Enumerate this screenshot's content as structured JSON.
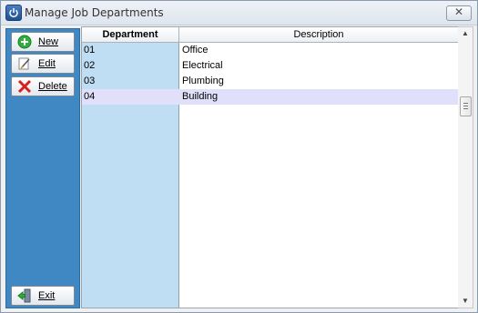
{
  "window": {
    "title": "Manage Job Departments",
    "close_glyph": "✕"
  },
  "sidebar": {
    "new_label": "New",
    "edit_label": "Edit",
    "delete_label": "Delete",
    "exit_label": "Exit"
  },
  "grid": {
    "columns": {
      "department": "Department",
      "description": "Description"
    },
    "rows": [
      {
        "department": "01",
        "description": "Office"
      },
      {
        "department": "02",
        "description": "Electrical"
      },
      {
        "department": "03",
        "description": "Plumbing"
      },
      {
        "department": "04",
        "description": "Building"
      }
    ],
    "selected_index": 3
  },
  "scrollbar": {
    "up_glyph": "▲",
    "down_glyph": "▼"
  },
  "colors": {
    "sidebar": "#3f88c3",
    "dept_column": "#bfddf3",
    "selected_row": "#e1e0fb"
  }
}
